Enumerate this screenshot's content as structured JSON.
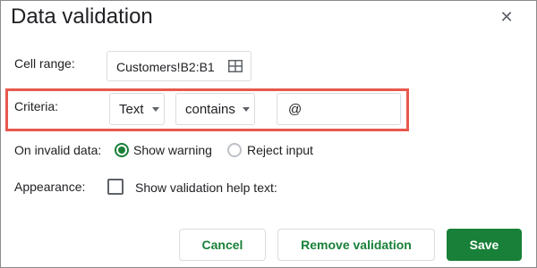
{
  "dialog": {
    "title": "Data validation",
    "close_icon": "close-icon"
  },
  "cell_range": {
    "label": "Cell range:",
    "value": "Customers!B2:B1",
    "icon": "grid-icon"
  },
  "criteria": {
    "label": "Criteria:",
    "type_selected": "Text",
    "condition_selected": "contains",
    "value": "@",
    "highlight_color": "#e8584d"
  },
  "invalid_data": {
    "label": "On invalid data:",
    "options": [
      {
        "label": "Show warning",
        "selected": true
      },
      {
        "label": "Reject input",
        "selected": false
      }
    ]
  },
  "appearance": {
    "label": "Appearance:",
    "checkbox_label": "Show validation help text:",
    "checked": false
  },
  "buttons": {
    "cancel": "Cancel",
    "remove": "Remove validation",
    "save": "Save"
  },
  "colors": {
    "accent": "#188038",
    "border": "#dadce0"
  }
}
